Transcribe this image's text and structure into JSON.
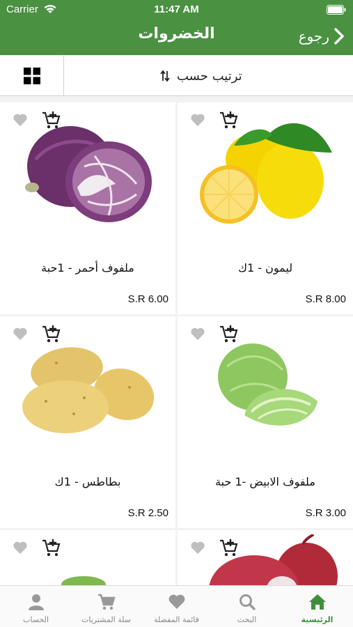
{
  "status_bar": {
    "carrier": "Carrier",
    "time": "11:47 AM"
  },
  "header": {
    "title": "الخضروات",
    "back_label": "رجوع"
  },
  "toolbar": {
    "sort_label": "ترتيب حسب"
  },
  "products": [
    {
      "name": "ليمون - 1ك",
      "price": "S.R 8.00"
    },
    {
      "name": "ملفوف أحمر - 1حبة",
      "price": "S.R 6.00"
    },
    {
      "name": "ملفوف الابيض -1 حبة",
      "price": "S.R 3.00"
    },
    {
      "name": "بطاطس - 1ك",
      "price": "S.R 2.50"
    }
  ],
  "tabbar": {
    "home": "الرئيسية",
    "search": "البحث",
    "favorites": "قائمة المفضلة",
    "cart": "سلة المشتريات",
    "account": "الحساب"
  },
  "colors": {
    "primary": "#4a9142",
    "active_tab": "#3f8f3a",
    "inactive": "#888888"
  }
}
